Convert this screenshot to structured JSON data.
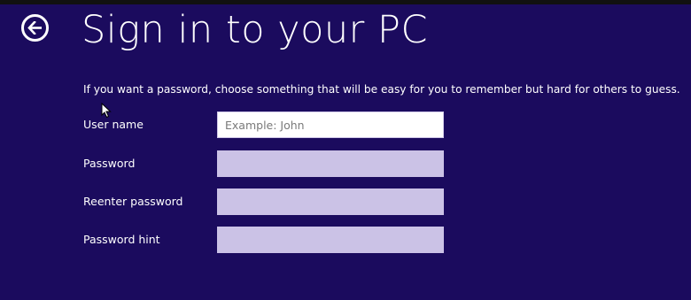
{
  "page": {
    "title": "Sign in to your PC",
    "instructions": "If you want a password, choose something that will be easy for you to remember but hard for others to guess."
  },
  "back_button": {
    "icon": "arrow-left-icon"
  },
  "form": {
    "fields": [
      {
        "label": "User name",
        "placeholder": "Example: John",
        "value": ""
      },
      {
        "label": "Password",
        "placeholder": "",
        "value": ""
      },
      {
        "label": "Reenter password",
        "placeholder": "",
        "value": ""
      },
      {
        "label": "Password hint",
        "placeholder": "",
        "value": ""
      }
    ]
  },
  "colors": {
    "background": "#1b0b5e",
    "active_field": "#ffffff",
    "inactive_field": "#cbc2e6",
    "text": "#ffffff"
  }
}
